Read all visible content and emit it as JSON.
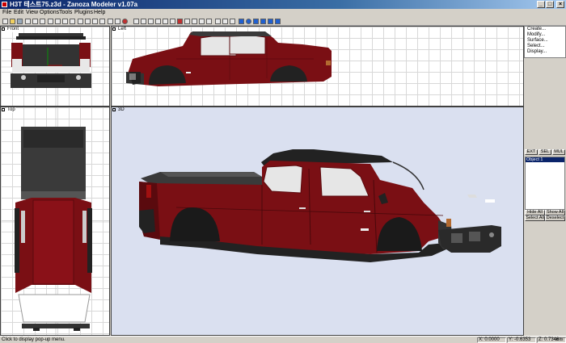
{
  "window": {
    "title": "H3T 테스트75.z3d - Zanoza Modeler v1.07a",
    "minimize": "_",
    "maximize": "□",
    "close": "×"
  },
  "menu": [
    "File",
    "Edit",
    "View",
    "Options",
    "Tools",
    "Plugins",
    "Help"
  ],
  "viewports": {
    "front": "Front",
    "left": "Left",
    "top": "Top",
    "perspective": "3D"
  },
  "panel": {
    "commands": [
      "Create...",
      "Modify...",
      "Surface...",
      "Select...",
      "Display..."
    ],
    "tabs": [
      "EXT",
      "SEL",
      "MUL"
    ],
    "objects": [
      "Object 1"
    ],
    "hide_all": "Hide All",
    "show_all": "Show All",
    "select_all": "Select All",
    "deselect": "Deselect"
  },
  "status": {
    "hint": "Click to display pop-up menu.",
    "x": "X: 0.0000",
    "y": "Y: -0.6353",
    "z": "Z: 0.7346",
    "units": "units"
  },
  "colors": {
    "body": "#7a0f14",
    "body_dark": "#5a0a0e",
    "trim": "#222222",
    "window_glass": "#e6e6e6",
    "viewport_3d_bg": "#dae0f0",
    "titlebar": "#0a246a"
  }
}
